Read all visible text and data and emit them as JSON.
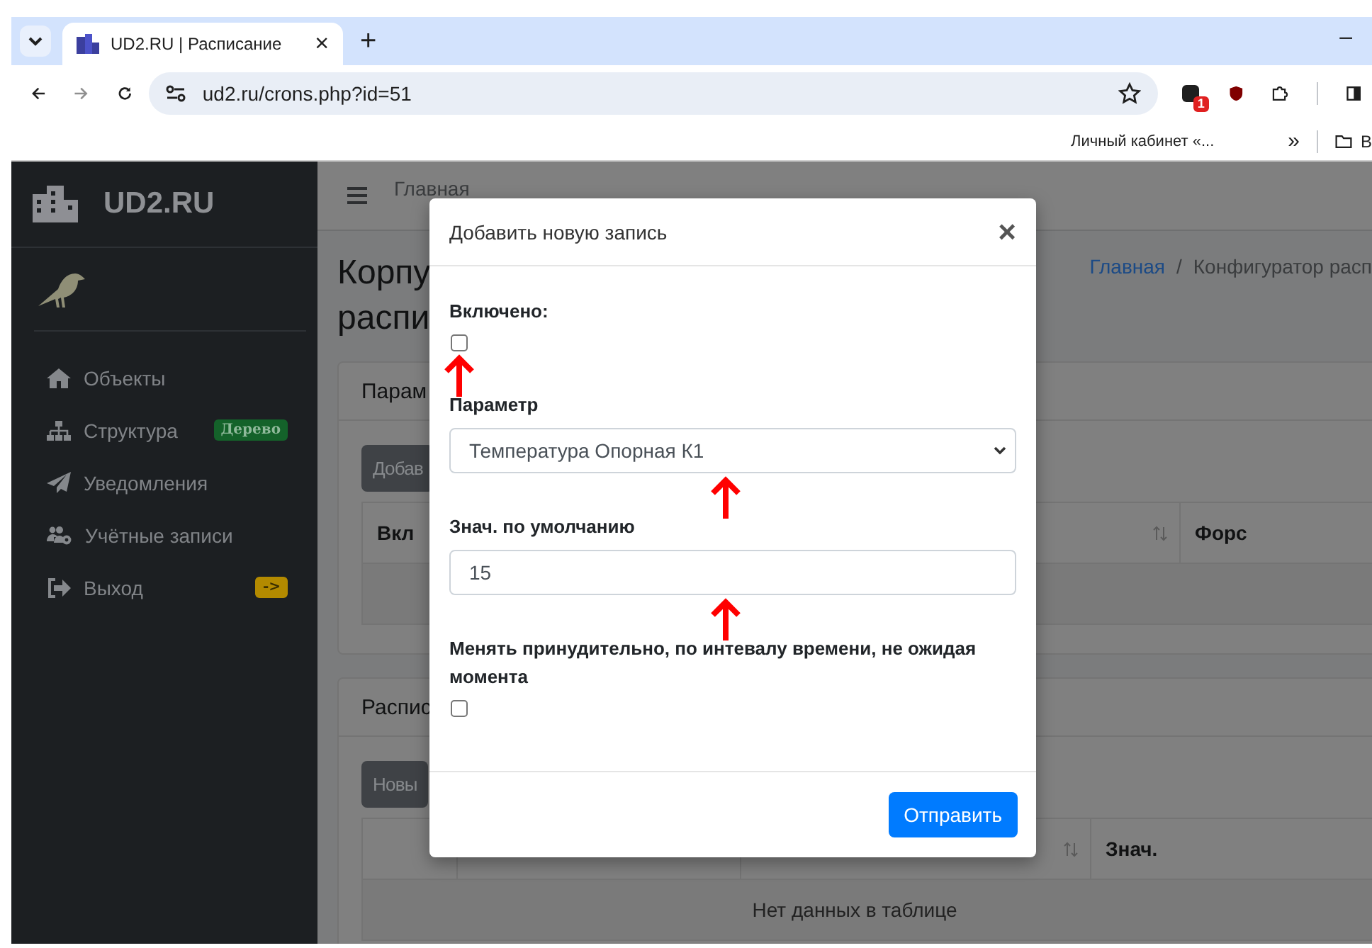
{
  "browser": {
    "tab": {
      "title": "UD2.RU | Расписание",
      "close": "×"
    },
    "new_tab": "+",
    "minimize": "–",
    "url": "ud2.ru/crons.php?id=51",
    "extension_badge": "1",
    "bookmarks": [
      {
        "label": "Личный кабинет «..."
      }
    ],
    "more_bookmarks": "»",
    "folder_label": "В"
  },
  "sidebar": {
    "brand": "UD2.RU",
    "items": [
      {
        "label": "Объекты"
      },
      {
        "label": "Структура",
        "badge": "Дерево",
        "color": "#14622a"
      },
      {
        "label": "Уведомления"
      },
      {
        "label": "Учётные записи"
      },
      {
        "label": "Выход",
        "badge": "->",
        "color": "#b38a00"
      }
    ]
  },
  "topbar": {
    "link": "Главная"
  },
  "page": {
    "title_lines": [
      "Корпу",
      "распи"
    ],
    "breadcrumb_separator": "/",
    "breadcrumb": [
      {
        "label": "Главная",
        "kind": "link"
      },
      {
        "label": "Конфигуратор расп",
        "kind": "current"
      }
    ]
  },
  "cards": [
    {
      "title": "Парам",
      "button": "Добав",
      "columns": [
        {
          "label": "Вкл",
          "sortable": false
        },
        {
          "sortable": true
        },
        {
          "label": "Форс",
          "sortable": false
        }
      ]
    },
    {
      "title": "Распис",
      "button": "Новы",
      "columns": [
        {
          "sortable": false
        },
        {
          "sortable": false
        },
        {
          "sortable": true
        },
        {
          "label": "Знач.",
          "sortable": false
        }
      ],
      "empty_text": "Нет данных в таблице"
    }
  ],
  "modal": {
    "title": "Добавить новую запись",
    "close": "×",
    "fields": [
      {
        "kind": "checkbox",
        "label": "Включено:",
        "checked": false,
        "arrow": true
      },
      {
        "kind": "select",
        "label": "Параметр",
        "value": "Температура Опорная К1",
        "arrow": true
      },
      {
        "kind": "text",
        "label": "Знач. по умолчанию",
        "value": "15",
        "arrow": true
      },
      {
        "kind": "checkbox",
        "label": "Менять принудительно, по интевалу времени, не ожидая момента",
        "checked": false,
        "arrow": false
      }
    ],
    "submit": "Отправить"
  }
}
